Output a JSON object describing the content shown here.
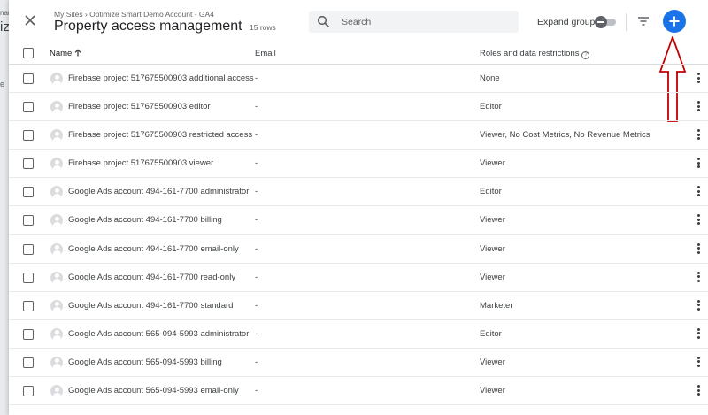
{
  "background": {
    "fragment_1": "nar",
    "fragment_2": "iz",
    "fragment_3": "e"
  },
  "header": {
    "breadcrumb": "My Sites › Optimize Smart Demo Account - GA4",
    "title": "Property access management",
    "row_count": "15 rows",
    "search_placeholder": "Search",
    "expand_groups_label": "Expand groups",
    "accent_color": "#1a73e8"
  },
  "annotation": {
    "arrow_color": "#c00000"
  },
  "table": {
    "columns": {
      "name": "Name",
      "email": "Email",
      "roles": "Roles and data restrictions"
    },
    "rows": [
      {
        "name": "Firebase project 517675500903 additional access",
        "email": "-",
        "roles": "None"
      },
      {
        "name": "Firebase project 517675500903 editor",
        "email": "-",
        "roles": "Editor"
      },
      {
        "name": "Firebase project 517675500903 restricted access",
        "email": "-",
        "roles": "Viewer, No Cost Metrics, No Revenue Metrics"
      },
      {
        "name": "Firebase project 517675500903 viewer",
        "email": "-",
        "roles": "Viewer"
      },
      {
        "name": "Google Ads account 494-161-7700 administrator",
        "email": "-",
        "roles": "Editor"
      },
      {
        "name": "Google Ads account 494-161-7700 billing",
        "email": "-",
        "roles": "Viewer"
      },
      {
        "name": "Google Ads account 494-161-7700 email-only",
        "email": "-",
        "roles": "Viewer"
      },
      {
        "name": "Google Ads account 494-161-7700 read-only",
        "email": "-",
        "roles": "Viewer"
      },
      {
        "name": "Google Ads account 494-161-7700 standard",
        "email": "-",
        "roles": "Marketer"
      },
      {
        "name": "Google Ads account 565-094-5993 administrator",
        "email": "-",
        "roles": "Editor"
      },
      {
        "name": "Google Ads account 565-094-5993 billing",
        "email": "-",
        "roles": "Viewer"
      },
      {
        "name": "Google Ads account 565-094-5993 email-only",
        "email": "-",
        "roles": "Viewer"
      }
    ]
  }
}
